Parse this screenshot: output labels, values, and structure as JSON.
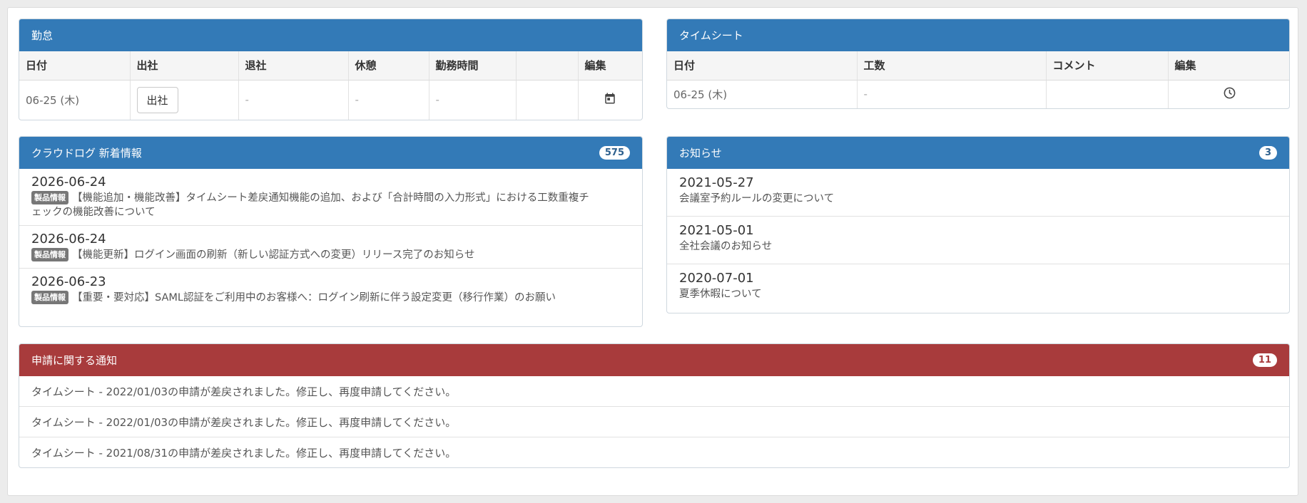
{
  "attendance": {
    "title": "勤怠",
    "columns": [
      "日付",
      "出社",
      "退社",
      "休憩",
      "勤務時間",
      "",
      "編集"
    ],
    "row": {
      "date": "06-25 (木)",
      "clock_in_button": "出社",
      "clock_out": "-",
      "break": "-",
      "work_time": "-",
      "edit_icon": "calendar-icon"
    }
  },
  "timesheet": {
    "title": "タイムシート",
    "columns": [
      "日付",
      "工数",
      "コメント",
      "編集"
    ],
    "row": {
      "date": "06-25 (木)",
      "hours": "-",
      "comment": "",
      "edit_icon": "clock-icon"
    }
  },
  "crowdlog_news": {
    "title": "クラウドログ 新着情報",
    "count": "575",
    "items": [
      {
        "date": "2026-06-24",
        "tag": "製品情報",
        "text": "【機能追加・機能改善】タイムシート差戻通知機能の追加、および「合計時間の入力形式」における工数重複チ",
        "text2": "ェックの機能改善について"
      },
      {
        "date": "2026-06-24",
        "tag": "製品情報",
        "text": "【機能更新】ログイン画面の刷新（新しい認証方式への変更）リリース完了のお知らせ"
      },
      {
        "date": "2026-06-23",
        "tag": "製品情報",
        "text": "【重要・要対応】SAML認証をご利用中のお客様へ：ログイン刷新に伴う設定変更（移行作業）のお願い"
      }
    ]
  },
  "notices": {
    "title": "お知らせ",
    "count": "3",
    "items": [
      {
        "date": "2021-05-27",
        "text": "会議室予約ルールの変更について"
      },
      {
        "date": "2021-05-01",
        "text": "全社会議のお知らせ"
      },
      {
        "date": "2020-07-01",
        "text": "夏季休暇について"
      }
    ]
  },
  "requests": {
    "title": "申請に関する通知",
    "count": "11",
    "items": [
      "タイムシート - 2022/01/03の申請が差戻されました。修正し、再度申請してください。",
      "タイムシート - 2022/01/03の申請が差戻されました。修正し、再度申請してください。",
      "タイムシート - 2021/08/31の申請が差戻されました。修正し、再度申請してください。"
    ]
  },
  "colors": {
    "panel_header": "#337ab7",
    "alert_header": "#a83b3c",
    "tag": "#777777"
  }
}
